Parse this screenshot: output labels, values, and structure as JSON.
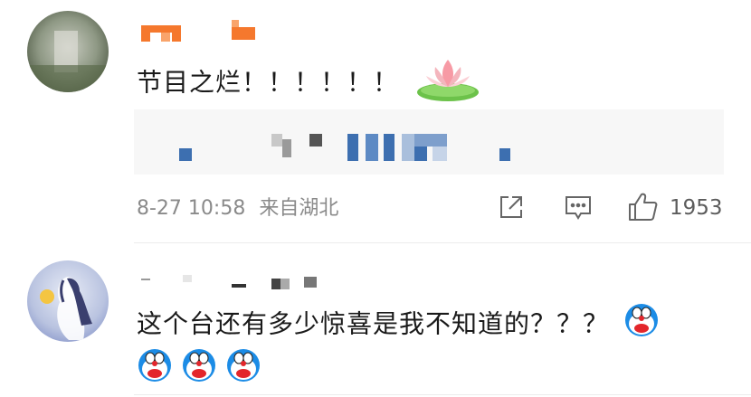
{
  "comments": [
    {
      "text": "节目之烂！！！！！！",
      "time": "8-27 10:58",
      "location": "来自湖北",
      "likes": "1953",
      "emoji": [
        "lotus-emoji"
      ],
      "actions": [
        "share-icon",
        "comment-icon",
        "like-icon"
      ]
    },
    {
      "text": "这个台还有多少惊喜是我不知道的？？？",
      "emoji_inline": [
        "doraemon-emoji"
      ],
      "emoji_row": [
        "doraemon-emoji",
        "doraemon-emoji",
        "doraemon-emoji"
      ]
    }
  ],
  "colors": {
    "text": "#1a1a1a",
    "meta": "#8a8a8a",
    "username_orange": "#f5782d",
    "pixel_blue": "#3d6fb0",
    "divider": "#ececec"
  }
}
